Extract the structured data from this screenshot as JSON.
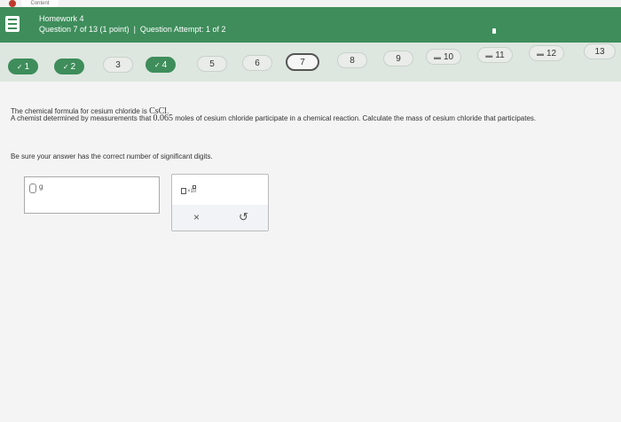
{
  "tab": {
    "label": "Content"
  },
  "header": {
    "title": "Homework 4",
    "question_info": "Question 7 of 13 (1 point)",
    "attempt": "Question Attempt: 1 of 2"
  },
  "nav": {
    "questions": [
      {
        "label": "1",
        "state": "done"
      },
      {
        "label": "2",
        "state": "done"
      },
      {
        "label": "3",
        "state": "plain"
      },
      {
        "label": "4",
        "state": "done"
      },
      {
        "label": "5",
        "state": "plain"
      },
      {
        "label": "6",
        "state": "plain"
      },
      {
        "label": "7",
        "state": "current"
      },
      {
        "label": "8",
        "state": "plain"
      },
      {
        "label": "9",
        "state": "plain"
      },
      {
        "label": "10",
        "state": "partial"
      },
      {
        "label": "11",
        "state": "partial"
      },
      {
        "label": "12",
        "state": "partial"
      },
      {
        "label": "13",
        "state": "plain"
      }
    ]
  },
  "question": {
    "formula_intro": "The chemical formula for cesium chloride is",
    "formula": "CsCl",
    "prompt_a": "A chemist determined by measurements that",
    "amount": "0.065",
    "prompt_b": "moles of cesium chloride participate in a chemical reaction. Calculate the mass of cesium chloride that participates.",
    "instruction": "Be sure your answer has the correct number of significant digits."
  },
  "answer": {
    "value": "",
    "unit": "g"
  },
  "tools": {
    "clear_label": "×",
    "undo_label": "↺"
  },
  "colors": {
    "header": "#3e8d5b",
    "nav": "#dde7df"
  }
}
